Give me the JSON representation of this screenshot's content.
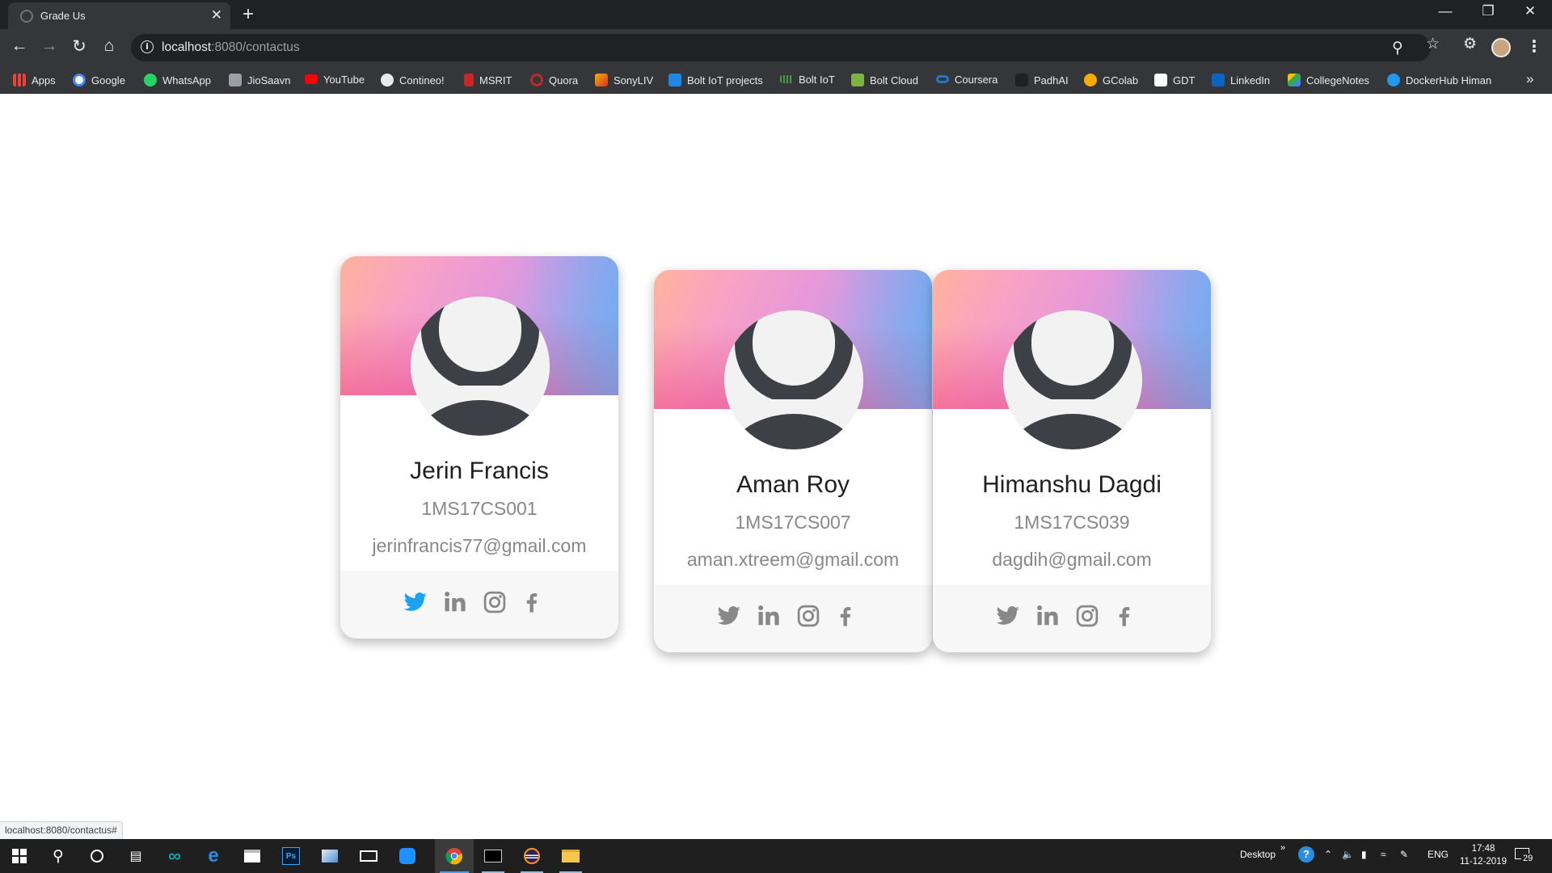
{
  "browser": {
    "tab_title": "Grade Us",
    "tab_close": "✕",
    "new_tab": "+",
    "url_host": "localhost",
    "url_rest": ":8080/contactus",
    "bookmarks": [
      {
        "label": "Apps",
        "color": "#ea4335"
      },
      {
        "label": "Google",
        "color": "#4285f4"
      },
      {
        "label": "WhatsApp",
        "color": "#25d366"
      },
      {
        "label": "JioSaavn",
        "color": "#9aa0a6"
      },
      {
        "label": "YouTube",
        "color": "#ff0000"
      },
      {
        "label": "Contineo!",
        "color": "#e8eaed"
      },
      {
        "label": "MSRIT",
        "color": "#c62828"
      },
      {
        "label": "Quora",
        "color": "#b92b27"
      },
      {
        "label": "SonyLIV",
        "color": "#f4b400"
      },
      {
        "label": "Bolt IoT projects",
        "color": "#1e88e5"
      },
      {
        "label": "Bolt IoT",
        "color": "#43a047"
      },
      {
        "label": "Bolt Cloud",
        "color": "#7cb342"
      },
      {
        "label": "Coursera",
        "color": "#2a73cc"
      },
      {
        "label": "PadhAI",
        "color": "#212121"
      },
      {
        "label": "GColab",
        "color": "#f9ab00"
      },
      {
        "label": "GDT",
        "color": "#ffffff"
      },
      {
        "label": "LinkedIn",
        "color": "#0a66c2"
      },
      {
        "label": "CollegeNotes",
        "color": "#34a853"
      },
      {
        "label": "DockerHub Himan",
        "color": "#2496ed"
      }
    ],
    "bookmarks_more": "»"
  },
  "contacts": [
    {
      "name": "Jerin Francis",
      "usn": "1MS17CS001",
      "email": "jerinfrancis77@gmail.com",
      "twitter_color": "#1da1f2"
    },
    {
      "name": "Aman Roy",
      "usn": "1MS17CS007",
      "email": "aman.xtreem@gmail.com",
      "twitter_color": "#888888"
    },
    {
      "name": "Himanshu Dagdi",
      "usn": "1MS17CS039",
      "email": "dagdih@gmail.com",
      "twitter_color": "#888888"
    }
  ],
  "status_url": "localhost:8080/contactus#",
  "taskbar": {
    "desktop_label": "Desktop",
    "lang": "ENG",
    "time": "17:48",
    "date": "11-12-2019",
    "notifications": "29"
  },
  "colors": {
    "social_grey": "#888888",
    "avatar_dark": "#3d4046",
    "twitter_active": "#1da1f2"
  }
}
